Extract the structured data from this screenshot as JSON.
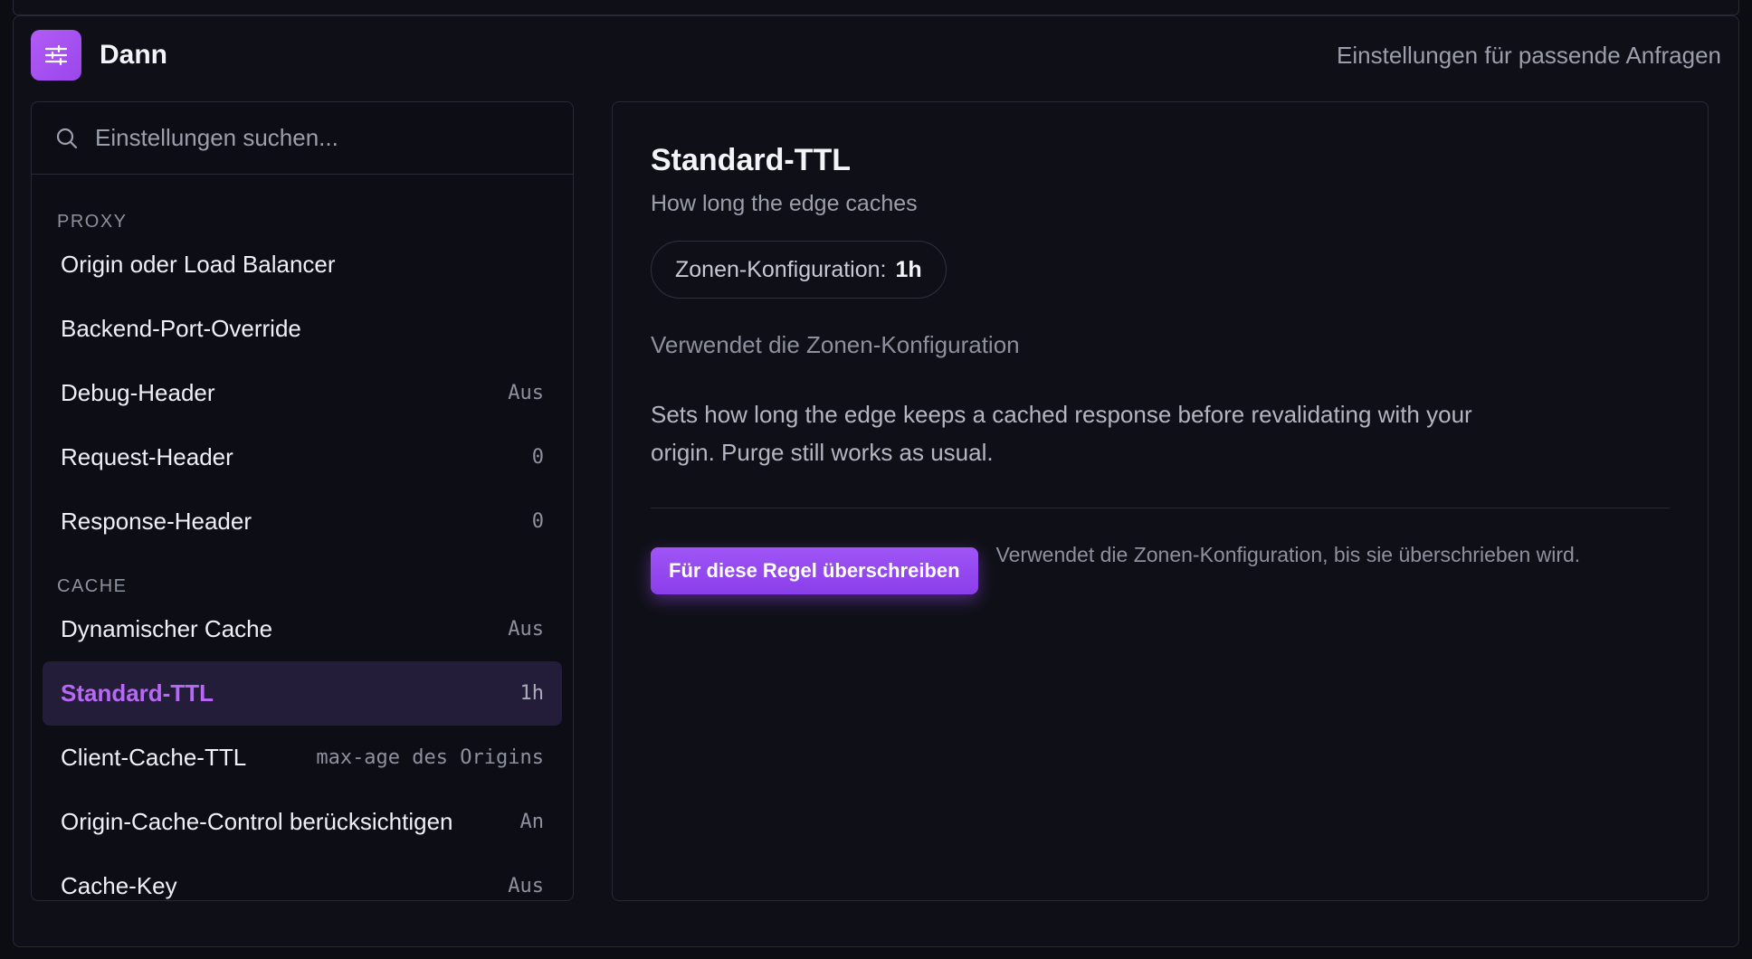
{
  "header": {
    "title": "Dann",
    "subtitle": "Einstellungen für passende Anfragen"
  },
  "search": {
    "placeholder": "Einstellungen suchen..."
  },
  "sections": [
    {
      "label": "PROXY",
      "items": [
        {
          "label": "Origin oder Load Balancer",
          "value": ""
        },
        {
          "label": "Backend-Port-Override",
          "value": ""
        },
        {
          "label": "Debug-Header",
          "value": "Aus"
        },
        {
          "label": "Request-Header",
          "value": "0"
        },
        {
          "label": "Response-Header",
          "value": "0"
        }
      ]
    },
    {
      "label": "CACHE",
      "items": [
        {
          "label": "Dynamischer Cache",
          "value": "Aus"
        },
        {
          "label": "Standard-TTL",
          "value": "1h"
        },
        {
          "label": "Client-Cache-TTL",
          "value": "max-age des Origins"
        },
        {
          "label": "Origin-Cache-Control berücksichtigen",
          "value": "An"
        },
        {
          "label": "Cache-Key",
          "value": "Aus"
        }
      ]
    }
  ],
  "detail": {
    "title": "Standard-TTL",
    "subtitle": "How long the edge caches",
    "pill_label": "Zonen-Konfiguration:",
    "pill_value": "1h",
    "uses_zone": "Verwendet die Zonen-Konfiguration",
    "description": "Sets how long the edge keeps a cached response before revalidating with your origin. Purge still works as usual.",
    "override_button": "Für diese Regel überschreiben",
    "override_hint": "Verwendet die Zonen-Konfiguration, bis sie überschrieben wird."
  },
  "colors": {
    "accent": "#9a46ec",
    "active_text": "#b768f4",
    "background": "#0f1017"
  }
}
